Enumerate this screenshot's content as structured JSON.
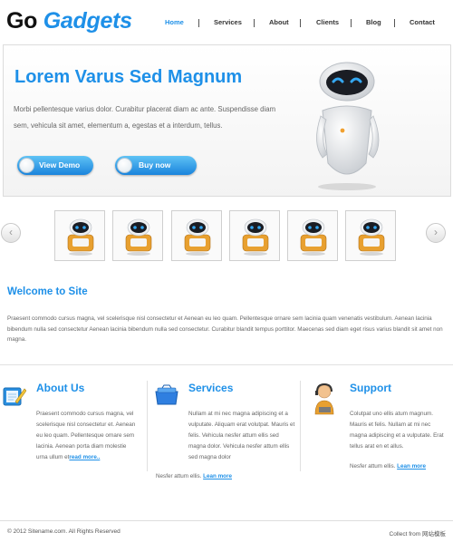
{
  "header": {
    "logo_part1": "Go",
    "logo_part2": "Gadgets",
    "nav": [
      {
        "label": "Home",
        "active": true
      },
      {
        "label": "Services"
      },
      {
        "label": "About"
      },
      {
        "label": "Clients"
      },
      {
        "label": "Blog"
      },
      {
        "label": "Contact"
      }
    ]
  },
  "hero": {
    "title": "Lorem Varus Sed Magnum",
    "text": "Morbi pellentesque varius dolor. Curabitur placerat diam ac ante. Suspendisse diam sem, vehicula sit amet, elementum a, egestas et a interdum, tellus.",
    "buttons": [
      "View Demo",
      "Buy now"
    ]
  },
  "carousel": {
    "prev_icon": "chevron-left-icon",
    "next_icon": "chevron-right-icon",
    "thumb_count": 6
  },
  "welcome": {
    "title": "Welcome to Site",
    "text": "Praesent commodo cursus magna, vel scelerisque nisl consectetur et Aenean eu leo quam. Pellentesque ornare sem lacinia quam venenatis vestibulum. Aenean lacinia bibendum nulla sed consectetur Aenean lacinia bibendum nulla sed consectetur. Curabitur blandit tempus porttitor. Maecenas sed diam eget risus varius blandit sit amet non magna."
  },
  "columns": [
    {
      "title": "About Us",
      "icon": "notepad-pencil-icon",
      "text": "Praesent commodo cursus magna, vel scelerisque nisl consectetur et. Aenean eu leo quam. Pellentesque ornare sem lacinia. Aenean porta diam molestie urna ullum et",
      "link": "read more.."
    },
    {
      "title": "Services",
      "icon": "toolbox-icon",
      "text": "Nullam at mi nec magna adipiscing et a vulputate. Aliquam erat volutpat. Mauris et felis. Vehicula nesfer attum ellis sed magna dolor. Vehicula nesfer attum ellis sed magna dolor",
      "text2": "Nesfer attum ellis.",
      "link": "Lean more"
    },
    {
      "title": "Support",
      "icon": "support-agent-icon",
      "text": "Colutpat uno ellis atum magnum. Mauris et felis. Nullam at mi nec magna adipiscing et a vulputate. Erat tellus arat en et allus.",
      "text2": "Nesfer attum ellis.",
      "link": "Lean more"
    }
  ],
  "footer": {
    "copyright": "© 2012 Sitename.com. All Rights Reserved",
    "credit": "Collect from 网站模板"
  },
  "colors": {
    "accent": "#1e90e8",
    "text": "#666666"
  }
}
